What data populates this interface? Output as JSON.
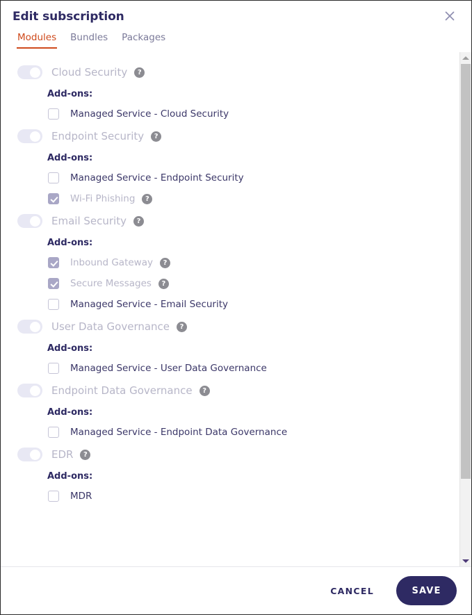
{
  "dialog": {
    "title": "Edit subscription",
    "close_icon": "close-icon"
  },
  "tabs": [
    {
      "label": "Modules",
      "active": true
    },
    {
      "label": "Bundles",
      "active": false
    },
    {
      "label": "Packages",
      "active": false
    }
  ],
  "addons_label": "Add-ons:",
  "help_glyph": "?",
  "modules": [
    {
      "name": "Cloud Security",
      "enabled": true,
      "disabled": true,
      "has_help": true,
      "addons": [
        {
          "label": "Managed Service - Cloud Security",
          "checked": false,
          "disabled": false,
          "has_help": false
        }
      ]
    },
    {
      "name": "Endpoint Security",
      "enabled": true,
      "disabled": true,
      "has_help": true,
      "addons": [
        {
          "label": "Managed Service - Endpoint Security",
          "checked": false,
          "disabled": false,
          "has_help": false
        },
        {
          "label": "Wi-Fi Phishing",
          "checked": true,
          "disabled": true,
          "has_help": true
        }
      ]
    },
    {
      "name": "Email Security",
      "enabled": true,
      "disabled": true,
      "has_help": true,
      "addons": [
        {
          "label": "Inbound Gateway",
          "checked": true,
          "disabled": true,
          "has_help": true
        },
        {
          "label": "Secure Messages",
          "checked": true,
          "disabled": true,
          "has_help": true
        },
        {
          "label": "Managed Service - Email Security",
          "checked": false,
          "disabled": false,
          "has_help": false
        }
      ]
    },
    {
      "name": "User Data Governance",
      "enabled": true,
      "disabled": true,
      "has_help": true,
      "addons": [
        {
          "label": "Managed Service - User Data Governance",
          "checked": false,
          "disabled": false,
          "has_help": false
        }
      ]
    },
    {
      "name": "Endpoint Data Governance",
      "enabled": true,
      "disabled": true,
      "has_help": true,
      "addons": [
        {
          "label": "Managed Service - Endpoint Data Governance",
          "checked": false,
          "disabled": false,
          "has_help": false
        }
      ]
    },
    {
      "name": "EDR",
      "enabled": true,
      "disabled": true,
      "has_help": true,
      "addons": [
        {
          "label": "MDR",
          "checked": false,
          "disabled": false,
          "has_help": false
        }
      ]
    }
  ],
  "footer": {
    "cancel_label": "CANCEL",
    "save_label": "SAVE"
  },
  "colors": {
    "accent_orange": "#cf4a1c",
    "navy": "#2e2a63",
    "disabled_text": "#b7b6c8",
    "toggle_track": "#e8e8f4",
    "checkbox_checked": "#a9a7c6"
  }
}
